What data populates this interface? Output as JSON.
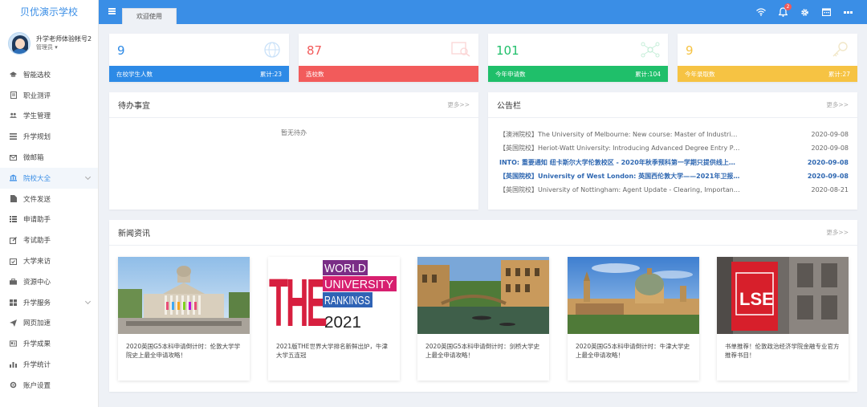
{
  "sidebar": {
    "logo": "贝优演示学校",
    "user_name": "升学老师体验帐号2",
    "user_role": "管理员",
    "items": [
      {
        "label": "智能选校",
        "icon": "mortarboard-icon"
      },
      {
        "label": "职业测评",
        "icon": "clipboard-icon"
      },
      {
        "label": "学生管理",
        "icon": "users-icon"
      },
      {
        "label": "升学规划",
        "icon": "list-icon"
      },
      {
        "label": "微邮箱",
        "icon": "envelope-icon"
      },
      {
        "label": "院校大全",
        "icon": "institution-icon"
      },
      {
        "label": "文件发送",
        "icon": "file-icon"
      },
      {
        "label": "申请助手",
        "icon": "list-bullet-icon"
      },
      {
        "label": "考试助手",
        "icon": "edit-icon"
      },
      {
        "label": "大学来访",
        "icon": "calendar-check-icon"
      },
      {
        "label": "资源中心",
        "icon": "briefcase-icon"
      },
      {
        "label": "升学服务",
        "icon": "grid-icon"
      },
      {
        "label": "网页加速",
        "icon": "paper-plane-icon"
      },
      {
        "label": "升学成果",
        "icon": "id-card-icon"
      },
      {
        "label": "升学统计",
        "icon": "bar-chart-icon"
      },
      {
        "label": "账户设置",
        "icon": "gear-icon"
      }
    ]
  },
  "topbar": {
    "tab_label": "欢迎使用",
    "notification_count": "2"
  },
  "stats": [
    {
      "value": "9",
      "label": "在校学生人数",
      "total": "累计:23",
      "color": "#2d8ae6",
      "icon": "globe-icon"
    },
    {
      "value": "87",
      "label": "选校数",
      "total": "",
      "color": "#f25b5b",
      "icon": "search-doc-icon"
    },
    {
      "value": "101",
      "label": "今年申请数",
      "total": "累计:104",
      "color": "#1fbf6a",
      "icon": "network-icon"
    },
    {
      "value": "9",
      "label": "今年录取数",
      "total": "累计:27",
      "color": "#f6c343",
      "icon": "key-icon"
    }
  ],
  "todo": {
    "title": "待办事宜",
    "more": "更多>>",
    "empty": "暂无待办"
  },
  "notices": {
    "title": "公告栏",
    "more": "更多>>",
    "items": [
      {
        "text": "【澳洲院校】The University of Melbourne: New course: Master of Industrial ...",
        "date": "2020-09-08",
        "highlight": false
      },
      {
        "text": "【英国院校】Heriot-Watt University: Introducing Advanced Degree Entry Pr...",
        "date": "2020-09-08",
        "highlight": false
      },
      {
        "text": "INTO: 重要通知 纽卡斯尔大学伦敦校区 - 2020年秋季预科第一学期只提供线上课...",
        "date": "2020-09-08",
        "highlight": true
      },
      {
        "text": "【英国院校】University of West London: 英国西伦敦大学——2021年卫报排...",
        "date": "2020-09-08",
        "highlight": true
      },
      {
        "text": "【英国院校】University of Nottingham: Agent Update - Clearing, Important ...",
        "date": "2020-08-21",
        "highlight": false
      }
    ]
  },
  "news": {
    "title": "新闻资讯",
    "more": "更多>>",
    "items": [
      {
        "caption": "2020英国G5本科申请倒计时：伦敦大学学院史上最全申请攻略！",
        "image": "ucl-building"
      },
      {
        "caption": "2021版THE世界大学排名新鲜出炉，牛津大学五连冠",
        "image": "the-rankings-logo"
      },
      {
        "caption": "2020英国G5本科申请倒计时：剑桥大学史上最全申请攻略！",
        "image": "cambridge-river"
      },
      {
        "caption": "2020英国G5本科申请倒计时：牛津大学史上最全申请攻略！",
        "image": "oxford-skyline"
      },
      {
        "caption": "书单推荐！伦敦政治经济学院金融专业官方推荐书目！",
        "image": "lse-sign"
      }
    ],
    "the_logo": {
      "line1": "WORLD",
      "line2": "UNIVERSITY",
      "line3": "RANKINGS",
      "year": "2021",
      "mark": "THE"
    },
    "lse_mark": "LSE"
  }
}
